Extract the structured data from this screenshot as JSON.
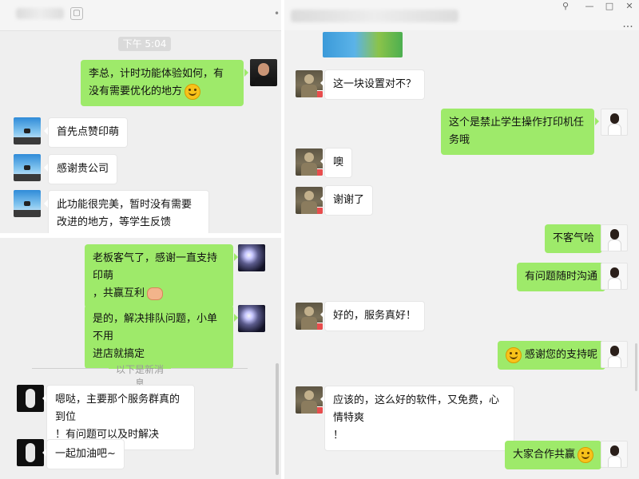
{
  "left_pane": {
    "timestamp": "下午 5:04",
    "messages": [
      {
        "side": "right",
        "text_line1": "李总，计时功能体验如何，有",
        "text_line2": "没有需要优化的地方",
        "emoji": "smile-emoji"
      },
      {
        "side": "left",
        "text": "首先点赞印萌"
      },
      {
        "side": "left",
        "text": "感谢贵公司"
      },
      {
        "side": "left",
        "text_line1": "此功能很完美，暂时没有需要",
        "text_line2": "改进的地方，等学生反馈"
      },
      {
        "side": "right",
        "text_line1": "老板客气了，感谢一直支持印萌",
        "text_line2": "，共赢互利",
        "emoji": "handshake-emoji"
      },
      {
        "side": "right",
        "text_line1": "是的，解决排队问题，小单不用",
        "text_line2": "进店就搞定"
      },
      {
        "side": "left",
        "text_line1": "嗯哒，主要那个服务群真的到位",
        "text_line2": "！有问题可以及时解决"
      },
      {
        "side": "left",
        "text": "一起加油吧~"
      }
    ],
    "new_messages_divider": "以下是新消息"
  },
  "right_pane": {
    "messages": [
      {
        "side": "left",
        "text": "这一块设置对不？"
      },
      {
        "side": "right",
        "text": "这个是禁止学生操作打印机任务哦"
      },
      {
        "side": "left",
        "text": "噢"
      },
      {
        "side": "left",
        "text": "谢谢了"
      },
      {
        "side": "right",
        "text": "不客气哈"
      },
      {
        "side": "right",
        "text": "有问题随时沟通"
      },
      {
        "side": "left",
        "text": "好的，服务真好！"
      },
      {
        "side": "right",
        "text": "感谢您的支持呢",
        "emoji": "smile-emoji"
      },
      {
        "side": "left",
        "text_line1": "应该的，这么好的软件，又免费，心情特爽",
        "text_line2": "！"
      },
      {
        "side": "right",
        "text": "大家合作共赢",
        "emoji": "smile-emoji"
      }
    ],
    "window_buttons": [
      "⚲",
      "—",
      "□",
      "✕"
    ],
    "more_button": "···"
  },
  "icons": {
    "left_header": "box-icon",
    "right_header": "dot-icon"
  }
}
